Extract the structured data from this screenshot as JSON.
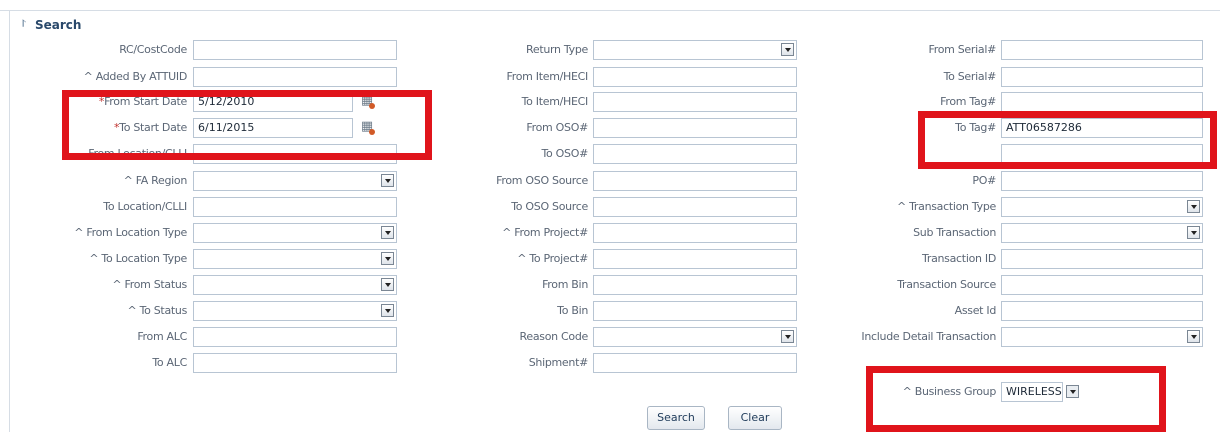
{
  "panel": {
    "title": "Search",
    "toggle_icon": "collapse-chevron-icon"
  },
  "columns": {
    "col1": [
      {
        "name": "rc-costcode",
        "label": "RC/CostCode",
        "type": "text",
        "value": ""
      },
      {
        "name": "added-by-attuid",
        "label": "^ Added By ATTUID",
        "type": "text",
        "value": ""
      },
      {
        "name": "from-start-date",
        "label": "From Start Date",
        "required": "*",
        "type": "date",
        "value": "5/12/2010"
      },
      {
        "name": "to-start-date",
        "label": "To Start Date",
        "required": "*",
        "type": "date",
        "value": "6/11/2015"
      },
      {
        "name": "from-location-clli",
        "label": "From Location/CLLI",
        "type": "text",
        "value": ""
      },
      {
        "name": "fa-region",
        "label": "^ FA Region",
        "type": "select",
        "value": ""
      },
      {
        "name": "to-location-clli",
        "label": "To Location/CLLI",
        "type": "text",
        "value": ""
      },
      {
        "name": "from-location-type",
        "label": "^ From Location Type",
        "type": "select",
        "value": ""
      },
      {
        "name": "to-location-type",
        "label": "^ To Location Type",
        "type": "select",
        "value": ""
      },
      {
        "name": "from-status",
        "label": "^ From Status",
        "type": "select",
        "value": ""
      },
      {
        "name": "to-status",
        "label": "^ To Status",
        "type": "select",
        "value": ""
      },
      {
        "name": "from-alc",
        "label": "From ALC",
        "type": "text",
        "value": ""
      },
      {
        "name": "to-alc",
        "label": "To ALC",
        "type": "text",
        "value": ""
      }
    ],
    "col2": [
      {
        "name": "return-type",
        "label": "Return Type",
        "type": "select",
        "value": ""
      },
      {
        "name": "from-item-heci",
        "label": "From Item/HECI",
        "type": "text",
        "value": ""
      },
      {
        "name": "to-item-heci",
        "label": "To Item/HECI",
        "type": "text",
        "value": ""
      },
      {
        "name": "from-oso",
        "label": "From OSO#",
        "type": "text",
        "value": ""
      },
      {
        "name": "to-oso",
        "label": "To OSO#",
        "type": "text",
        "value": ""
      },
      {
        "name": "from-oso-source",
        "label": "From OSO Source",
        "type": "text",
        "value": ""
      },
      {
        "name": "to-oso-source",
        "label": "To OSO Source",
        "type": "text",
        "value": ""
      },
      {
        "name": "from-project",
        "label": "^ From Project#",
        "type": "text",
        "value": ""
      },
      {
        "name": "to-project",
        "label": "^ To Project#",
        "type": "text",
        "value": ""
      },
      {
        "name": "from-bin",
        "label": "From Bin",
        "type": "text",
        "value": ""
      },
      {
        "name": "to-bin",
        "label": "To Bin",
        "type": "text",
        "value": ""
      },
      {
        "name": "reason-code",
        "label": "Reason Code",
        "type": "select",
        "value": ""
      },
      {
        "name": "shipment",
        "label": "Shipment#",
        "type": "text",
        "value": ""
      }
    ],
    "col3": [
      {
        "name": "from-serial",
        "label": "From Serial#",
        "type": "text",
        "value": ""
      },
      {
        "name": "to-serial",
        "label": "To Serial#",
        "type": "text",
        "value": ""
      },
      {
        "name": "from-tag",
        "label": "From Tag#",
        "type": "text",
        "value": ""
      },
      {
        "name": "to-tag",
        "label": "To Tag#",
        "type": "text",
        "value": "ATT06587286"
      },
      {
        "name": "po-hidden",
        "label": "",
        "type": "text",
        "value": ""
      },
      {
        "name": "po",
        "label": "PO#",
        "type": "text",
        "value": ""
      },
      {
        "name": "transaction-type",
        "label": "^ Transaction Type",
        "type": "select",
        "value": ""
      },
      {
        "name": "sub-transaction",
        "label": "Sub Transaction",
        "type": "select",
        "value": ""
      },
      {
        "name": "transaction-id",
        "label": "Transaction ID",
        "type": "text",
        "value": ""
      },
      {
        "name": "transaction-source",
        "label": "Transaction Source",
        "type": "text",
        "value": ""
      },
      {
        "name": "asset-id",
        "label": "Asset Id",
        "type": "text",
        "value": ""
      },
      {
        "name": "include-detail-transaction",
        "label": "Include Detail Transaction",
        "type": "select",
        "value": ""
      },
      {
        "name": "business-group",
        "label": "^ Business Group",
        "type": "select-small",
        "value": "WIRELESS"
      }
    ]
  },
  "buttons": {
    "search": "Search",
    "clear": "Clear"
  },
  "annotations": {
    "highlight_color": "#e0141b"
  }
}
